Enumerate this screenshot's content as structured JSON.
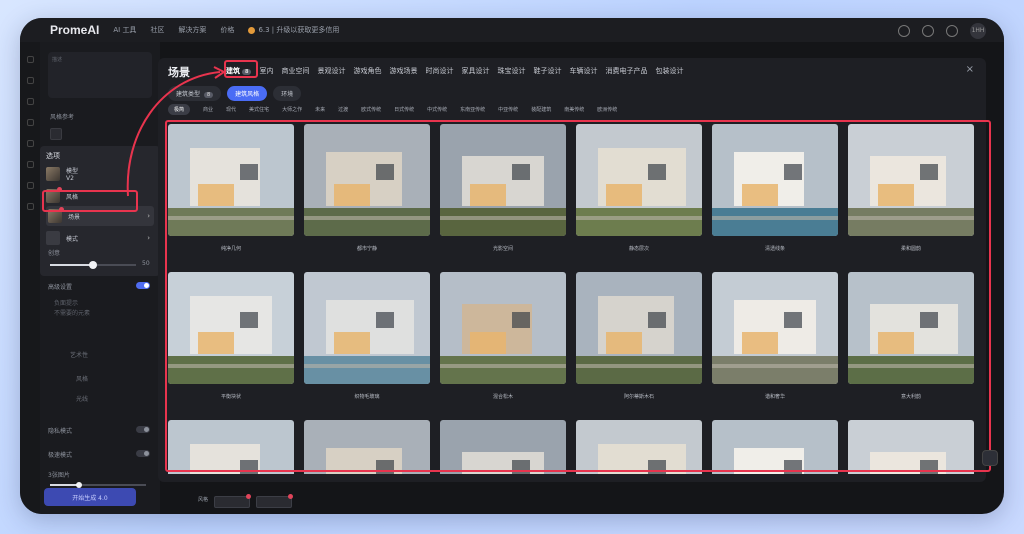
{
  "app": {
    "logo": "PromeAI",
    "top_nav": [
      "AI 工具",
      "社区",
      "解决方案",
      "价格",
      "6.3 | 升级以获取更多信用"
    ],
    "avatar": "1HH"
  },
  "sidebar": {
    "textarea_placeholder": "描述",
    "style_ref_label": "风格参考",
    "options_title": "选项",
    "options": [
      {
        "label": "模型",
        "sub": "V2"
      },
      {
        "label": "风格"
      },
      {
        "label": "场景"
      },
      {
        "label": "模式"
      }
    ],
    "creativity_label": "创意",
    "creativity_value": "50",
    "creativity_level": 0.5,
    "advanced_label": "高级设置",
    "advanced_desc_1": "负面提示",
    "advanced_desc_2": "不需要的元素",
    "art_label": "艺术性",
    "row_a": "风格",
    "row_b": "光线",
    "public_label": "隐私模式",
    "fast_label": "极速模式",
    "count_label": "3张图片",
    "generate_button": "开始生成 4.0"
  },
  "modal": {
    "title": "场景",
    "categories": [
      {
        "label": "建筑",
        "badge": "8",
        "active": true
      },
      {
        "label": "室内"
      },
      {
        "label": "商业空间"
      },
      {
        "label": "景观设计"
      },
      {
        "label": "游戏角色"
      },
      {
        "label": "游戏场景"
      },
      {
        "label": "时尚设计"
      },
      {
        "label": "家具设计"
      },
      {
        "label": "珠宝设计"
      },
      {
        "label": "鞋子设计"
      },
      {
        "label": "车辆设计"
      },
      {
        "label": "消费电子产品"
      },
      {
        "label": "包装设计"
      }
    ],
    "close_icon": "×",
    "sub_tabs": [
      {
        "label": "建筑类型",
        "badge": "8"
      },
      {
        "label": "建筑风格",
        "active": true
      },
      {
        "label": "环境"
      }
    ],
    "styles": [
      "极简",
      "商业",
      "现代",
      "美式住宅",
      "大师之作",
      "未来",
      "过渡",
      "欧式传统",
      "日式传统",
      "中式传统",
      "东南亚传统",
      "中亚传统",
      "装配建筑",
      "南美传统",
      "欧洲传统"
    ],
    "cards": [
      {
        "label": "纯净几何"
      },
      {
        "label": "都市宁静"
      },
      {
        "label": "光影空间"
      },
      {
        "label": "静态层次"
      },
      {
        "label": "清透线条"
      },
      {
        "label": "柔和圆韵"
      },
      {
        "label": "平衡块状"
      },
      {
        "label": "织物毛玻璃"
      },
      {
        "label": "混合松木"
      },
      {
        "label": "阿尔蒂斯木石"
      },
      {
        "label": "谐和奢华"
      },
      {
        "label": "意大利韵"
      },
      {
        "label": ""
      },
      {
        "label": ""
      },
      {
        "label": ""
      },
      {
        "label": ""
      },
      {
        "label": ""
      },
      {
        "label": ""
      }
    ]
  },
  "bottom": {
    "label": "风格",
    "thumb_1": "场景",
    "thumb_2": "写实"
  },
  "colors": {
    "accent": "#4a6cf5",
    "highlight": "#e8344e",
    "background": "#141518"
  }
}
